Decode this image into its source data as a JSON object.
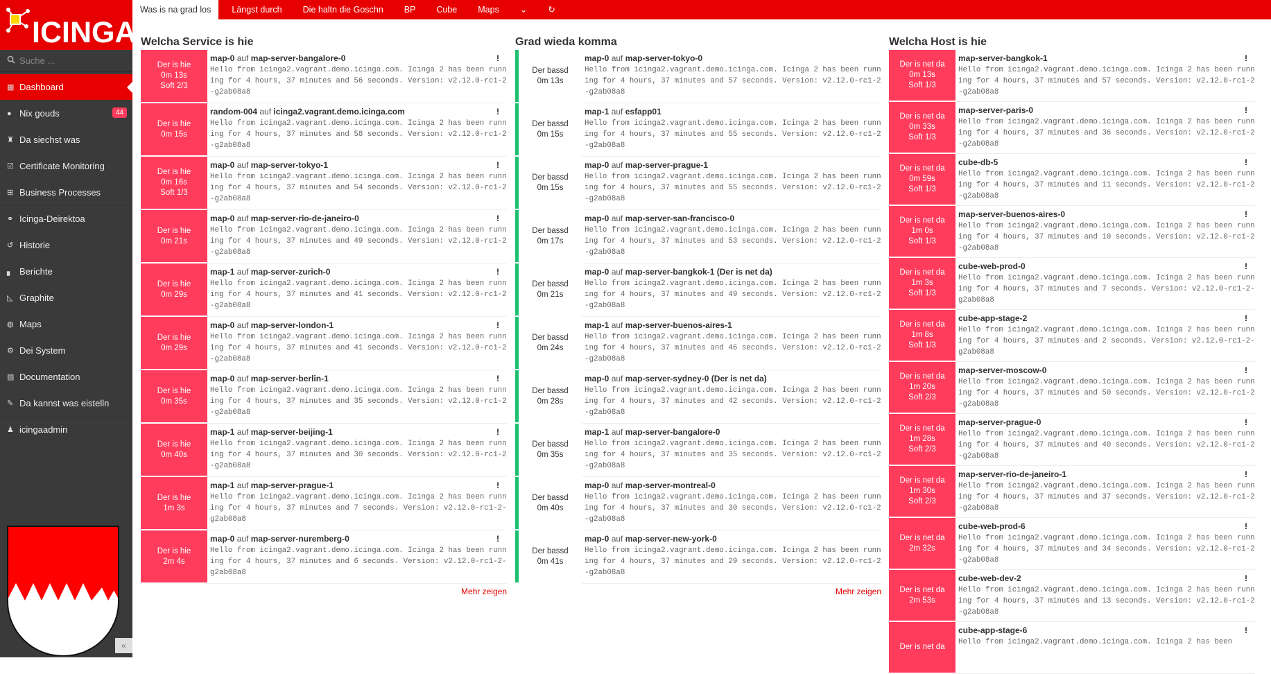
{
  "sidebar": {
    "search_placeholder": "Suche ...",
    "items": [
      {
        "label": "Dashboard",
        "icon": "dashboard-icon",
        "glyph": "▦",
        "active": true
      },
      {
        "label": "Nix gouds",
        "icon": "problems-icon",
        "glyph": "●",
        "badge": "44"
      },
      {
        "label": "Da siechst was",
        "icon": "binoculars-icon",
        "glyph": "♜"
      },
      {
        "label": "Certificate Monitoring",
        "icon": "check-icon",
        "glyph": "☑"
      },
      {
        "label": "Business Processes",
        "icon": "sitemap-icon",
        "glyph": "⊞"
      },
      {
        "label": "Icinga-Deirektoa",
        "icon": "director-icon",
        "glyph": "⚭"
      },
      {
        "label": "Historie",
        "icon": "history-icon",
        "glyph": "↺"
      },
      {
        "label": "Berichte",
        "icon": "bar-chart-icon",
        "glyph": "▖"
      },
      {
        "label": "Graphite",
        "icon": "area-chart-icon",
        "glyph": "◺"
      },
      {
        "label": "Maps",
        "icon": "globe-icon",
        "glyph": "◍"
      },
      {
        "label": "Dei System",
        "icon": "cogs-icon",
        "glyph": "⚙"
      },
      {
        "label": "Documentation",
        "icon": "book-icon",
        "glyph": "▤"
      },
      {
        "label": "Da kannst was eistelln",
        "icon": "wrench-icon",
        "glyph": "✎"
      },
      {
        "label": "icingaadmin",
        "icon": "user-icon",
        "glyph": "♟"
      }
    ],
    "collapse_glyph": "«"
  },
  "tabs": [
    {
      "label": "Was is na grad los",
      "active": true
    },
    {
      "label": "Längst durch"
    },
    {
      "label": "Die haltn die Goschn"
    },
    {
      "label": "BP"
    },
    {
      "label": "Cube"
    },
    {
      "label": "Maps"
    }
  ],
  "tab_menu_glyph": "⌄",
  "tab_refresh_glyph": "↻",
  "output_text": "Hello from icinga2.vagrant.demo.icinga.com. Icinga 2 has been running for 4 hours, 37 minutes and {t} seconds. Version: v2.12.0-rc1-2-g2ab08a8",
  "columns": {
    "services": {
      "title": "Welcha Service is hie",
      "more": "Mehr zeigen",
      "rows": [
        {
          "state": "Der is hie",
          "dur": "0m 13s",
          "soft": "Soft 2/3",
          "svc": "map-0",
          "host": "map-server-bangalore-0",
          "out": "Hello from icinga2.vagrant.demo.icinga.com. Icinga 2 has been running for 4 hours, 37 minutes and 56 seconds. Version: v2.12.0-rc1-2-g2ab08a8"
        },
        {
          "state": "Der is hie",
          "dur": "0m 15s",
          "soft": "",
          "svc": "random-004",
          "host": "icinga2.vagrant.demo.icinga.com",
          "out": "Hello from icinga2.vagrant.demo.icinga.com. Icinga 2 has been running for 4 hours, 37 minutes and 58 seconds. Version: v2.12.0-rc1-2-g2ab08a8"
        },
        {
          "state": "Der is hie",
          "dur": "0m 16s",
          "soft": "Soft 1/3",
          "svc": "map-0",
          "host": "map-server-tokyo-1",
          "out": "Hello from icinga2.vagrant.demo.icinga.com. Icinga 2 has been running for 4 hours, 37 minutes and 54 seconds. Version: v2.12.0-rc1-2-g2ab08a8"
        },
        {
          "state": "Der is hie",
          "dur": "0m 21s",
          "soft": "",
          "svc": "map-0",
          "host": "map-server-rio-de-janeiro-0",
          "out": "Hello from icinga2.vagrant.demo.icinga.com. Icinga 2 has been running for 4 hours, 37 minutes and 49 seconds. Version: v2.12.0-rc1-2-g2ab08a8"
        },
        {
          "state": "Der is hie",
          "dur": "0m 29s",
          "soft": "",
          "svc": "map-1",
          "host": "map-server-zurich-0",
          "out": "Hello from icinga2.vagrant.demo.icinga.com. Icinga 2 has been running for 4 hours, 37 minutes and 41 seconds. Version: v2.12.0-rc1-2-g2ab08a8"
        },
        {
          "state": "Der is hie",
          "dur": "0m 29s",
          "soft": "",
          "svc": "map-0",
          "host": "map-server-london-1",
          "out": "Hello from icinga2.vagrant.demo.icinga.com. Icinga 2 has been running for 4 hours, 37 minutes and 41 seconds. Version: v2.12.0-rc1-2-g2ab08a8"
        },
        {
          "state": "Der is hie",
          "dur": "0m 35s",
          "soft": "",
          "svc": "map-0",
          "host": "map-server-berlin-1",
          "out": "Hello from icinga2.vagrant.demo.icinga.com. Icinga 2 has been running for 4 hours, 37 minutes and 35 seconds. Version: v2.12.0-rc1-2-g2ab08a8"
        },
        {
          "state": "Der is hie",
          "dur": "0m 40s",
          "soft": "",
          "svc": "map-1",
          "host": "map-server-beijing-1",
          "out": "Hello from icinga2.vagrant.demo.icinga.com. Icinga 2 has been running for 4 hours, 37 minutes and 30 seconds. Version: v2.12.0-rc1-2-g2ab08a8"
        },
        {
          "state": "Der is hie",
          "dur": "1m 3s",
          "soft": "",
          "svc": "map-1",
          "host": "map-server-prague-1",
          "out": "Hello from icinga2.vagrant.demo.icinga.com. Icinga 2 has been running for 4 hours, 37 minutes and 7 seconds. Version: v2.12.0-rc1-2-g2ab08a8"
        },
        {
          "state": "Der is hie",
          "dur": "2m 4s",
          "soft": "",
          "svc": "map-0",
          "host": "map-server-nuremberg-0",
          "out": "Hello from icinga2.vagrant.demo.icinga.com. Icinga 2 has been running for 4 hours, 37 minutes and 6 seconds. Version: v2.12.0-rc1-2-g2ab08a8"
        }
      ]
    },
    "recovered": {
      "title": "Grad wieda komma",
      "more": "Mehr zeigen",
      "rows": [
        {
          "state": "Der bassd",
          "dur": "0m 13s",
          "svc": "map-0",
          "host": "map-server-tokyo-0",
          "hostnote": "",
          "out": "Hello from icinga2.vagrant.demo.icinga.com. Icinga 2 has been running for 4 hours, 37 minutes and 57 seconds. Version: v2.12.0-rc1-2-g2ab08a8"
        },
        {
          "state": "Der bassd",
          "dur": "0m 15s",
          "svc": "map-1",
          "host": "esfapp01",
          "hostnote": "",
          "out": "Hello from icinga2.vagrant.demo.icinga.com. Icinga 2 has been running for 4 hours, 37 minutes and 55 seconds. Version: v2.12.0-rc1-2-g2ab08a8"
        },
        {
          "state": "Der bassd",
          "dur": "0m 15s",
          "svc": "map-0",
          "host": "map-server-prague-1",
          "hostnote": "",
          "out": "Hello from icinga2.vagrant.demo.icinga.com. Icinga 2 has been running for 4 hours, 37 minutes and 55 seconds. Version: v2.12.0-rc1-2-g2ab08a8"
        },
        {
          "state": "Der bassd",
          "dur": "0m 17s",
          "svc": "map-0",
          "host": "map-server-san-francisco-0",
          "hostnote": "",
          "out": "Hello from icinga2.vagrant.demo.icinga.com. Icinga 2 has been running for 4 hours, 37 minutes and 53 seconds. Version: v2.12.0-rc1-2-g2ab08a8"
        },
        {
          "state": "Der bassd",
          "dur": "0m 21s",
          "svc": "map-0",
          "host": "map-server-bangkok-1",
          "hostnote": " (Der is net da)",
          "out": "Hello from icinga2.vagrant.demo.icinga.com. Icinga 2 has been running for 4 hours, 37 minutes and 49 seconds. Version: v2.12.0-rc1-2-g2ab08a8"
        },
        {
          "state": "Der bassd",
          "dur": "0m 24s",
          "svc": "map-1",
          "host": "map-server-buenos-aires-1",
          "hostnote": "",
          "out": "Hello from icinga2.vagrant.demo.icinga.com. Icinga 2 has been running for 4 hours, 37 minutes and 46 seconds. Version: v2.12.0-rc1-2-g2ab08a8"
        },
        {
          "state": "Der bassd",
          "dur": "0m 28s",
          "svc": "map-0",
          "host": "map-server-sydney-0",
          "hostnote": " (Der is net da)",
          "out": "Hello from icinga2.vagrant.demo.icinga.com. Icinga 2 has been running for 4 hours, 37 minutes and 42 seconds. Version: v2.12.0-rc1-2-g2ab08a8"
        },
        {
          "state": "Der bassd",
          "dur": "0m 35s",
          "svc": "map-1",
          "host": "map-server-bangalore-0",
          "hostnote": "",
          "out": "Hello from icinga2.vagrant.demo.icinga.com. Icinga 2 has been running for 4 hours, 37 minutes and 35 seconds. Version: v2.12.0-rc1-2-g2ab08a8"
        },
        {
          "state": "Der bassd",
          "dur": "0m 40s",
          "svc": "map-0",
          "host": "map-server-montreal-0",
          "hostnote": "",
          "out": "Hello from icinga2.vagrant.demo.icinga.com. Icinga 2 has been running for 4 hours, 37 minutes and 30 seconds. Version: v2.12.0-rc1-2-g2ab08a8"
        },
        {
          "state": "Der bassd",
          "dur": "0m 41s",
          "svc": "map-0",
          "host": "map-server-new-york-0",
          "hostnote": "",
          "out": "Hello from icinga2.vagrant.demo.icinga.com. Icinga 2 has been running for 4 hours, 37 minutes and 29 seconds. Version: v2.12.0-rc1-2-g2ab08a8"
        }
      ]
    },
    "hosts": {
      "title": "Welcha Host is hie",
      "rows": [
        {
          "state": "Der is net da",
          "dur": "0m 13s",
          "soft": "Soft 1/3",
          "host": "map-server-bangkok-1",
          "out": "Hello from icinga2.vagrant.demo.icinga.com. Icinga 2 has been running for 4 hours, 37 minutes and 57 seconds. Version: v2.12.0-rc1-2-g2ab08a8"
        },
        {
          "state": "Der is net da",
          "dur": "0m 33s",
          "soft": "Soft 1/3",
          "host": "map-server-paris-0",
          "out": "Hello from icinga2.vagrant.demo.icinga.com. Icinga 2 has been running for 4 hours, 37 minutes and 36 seconds. Version: v2.12.0-rc1-2-g2ab08a8"
        },
        {
          "state": "Der is net da",
          "dur": "0m 59s",
          "soft": "Soft 1/3",
          "host": "cube-db-5",
          "out": "Hello from icinga2.vagrant.demo.icinga.com. Icinga 2 has been running for 4 hours, 37 minutes and 11 seconds. Version: v2.12.0-rc1-2-g2ab08a8"
        },
        {
          "state": "Der is net da",
          "dur": "1m 0s",
          "soft": "Soft 1/3",
          "host": "map-server-buenos-aires-0",
          "out": "Hello from icinga2.vagrant.demo.icinga.com. Icinga 2 has been running for 4 hours, 37 minutes and 10 seconds. Version: v2.12.0-rc1-2-g2ab08a8"
        },
        {
          "state": "Der is net da",
          "dur": "1m 3s",
          "soft": "Soft 1/3",
          "host": "cube-web-prod-0",
          "out": "Hello from icinga2.vagrant.demo.icinga.com. Icinga 2 has been running for 4 hours, 37 minutes and 7 seconds. Version: v2.12.0-rc1-2-g2ab08a8"
        },
        {
          "state": "Der is net da",
          "dur": "1m 8s",
          "soft": "Soft 1/3",
          "host": "cube-app-stage-2",
          "out": "Hello from icinga2.vagrant.demo.icinga.com. Icinga 2 has been running for 4 hours, 37 minutes and 2 seconds. Version: v2.12.0-rc1-2-g2ab08a8"
        },
        {
          "state": "Der is net da",
          "dur": "1m 20s",
          "soft": "Soft 2/3",
          "host": "map-server-moscow-0",
          "out": "Hello from icinga2.vagrant.demo.icinga.com. Icinga 2 has been running for 4 hours, 37 minutes and 50 seconds. Version: v2.12.0-rc1-2-g2ab08a8"
        },
        {
          "state": "Der is net da",
          "dur": "1m 28s",
          "soft": "Soft 2/3",
          "host": "map-server-prague-0",
          "out": "Hello from icinga2.vagrant.demo.icinga.com. Icinga 2 has been running for 4 hours, 37 minutes and 40 seconds. Version: v2.12.0-rc1-2-g2ab08a8"
        },
        {
          "state": "Der is net da",
          "dur": "1m 30s",
          "soft": "Soft 2/3",
          "host": "map-server-rio-de-janeiro-1",
          "out": "Hello from icinga2.vagrant.demo.icinga.com. Icinga 2 has been running for 4 hours, 37 minutes and 37 seconds. Version: v2.12.0-rc1-2-g2ab08a8"
        },
        {
          "state": "Der is net da",
          "dur": "2m 32s",
          "soft": "",
          "host": "cube-web-prod-6",
          "out": "Hello from icinga2.vagrant.demo.icinga.com. Icinga 2 has been running for 4 hours, 37 minutes and 34 seconds. Version: v2.12.0-rc1-2-g2ab08a8"
        },
        {
          "state": "Der is net da",
          "dur": "2m 53s",
          "soft": "",
          "host": "cube-web-dev-2",
          "out": "Hello from icinga2.vagrant.demo.icinga.com. Icinga 2 has been running for 4 hours, 37 minutes and 13 seconds. Version: v2.12.0-rc1-2-g2ab08a8"
        },
        {
          "state": "Der is net da",
          "dur": "",
          "soft": "",
          "host": "cube-app-stage-6",
          "out": "Hello from icinga2.vagrant.demo.icinga.com. Icinga 2 has been"
        }
      ]
    }
  },
  "auf_word": "auf",
  "excl_glyph": "!",
  "logo_text": "ICINGA",
  "colors": {
    "brand": "#e60000",
    "critical": "#ff3c5c",
    "ok": "#1ec070",
    "sidebar": "#3a3a3a"
  }
}
